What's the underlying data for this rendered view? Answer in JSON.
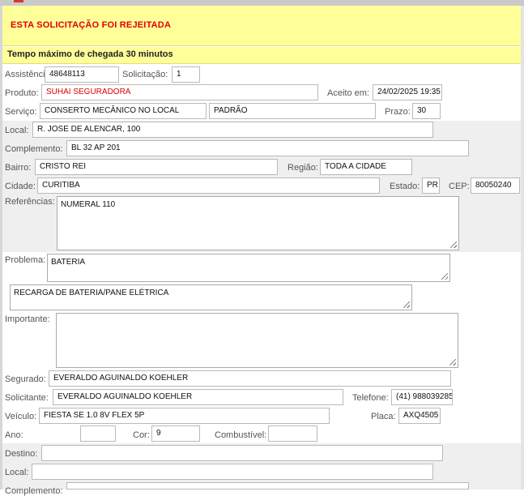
{
  "banner": {
    "rejected_text": "ESTA SOLICITAÇÃO FOI REJEITADA"
  },
  "tempo": {
    "text": "Tempo máximo de chegada 30 minutos"
  },
  "labels": {
    "assistencia": "Assistência:",
    "solicitacao": "Solicitação:",
    "produto": "Produto:",
    "aceito_em": "Aceito em:",
    "servico": "Serviço:",
    "prazo": "Prazo:",
    "local": "Local:",
    "complemento": "Complemento:",
    "bairro": "Bairro:",
    "regiao": "Região:",
    "cidade": "Cidade:",
    "estado": "Estado:",
    "cep": "CEP:",
    "referencias": "Referências:",
    "problema": "Problema:",
    "importante": "Importante:",
    "segurado": "Segurado:",
    "solicitante": "Solicitante:",
    "telefone": "Telefone:",
    "veiculo": "Veículo:",
    "placa": "Placa:",
    "ano": "Ano:",
    "cor": "Cor:",
    "combustivel": "Combustível:",
    "destino": "Destino:",
    "local2": "Local:",
    "complemento2": "Complemento:"
  },
  "values": {
    "assistencia": "48648113",
    "solicitacao": "1",
    "produto": "SUHAI SEGURADORA",
    "aceito_em": "24/02/2025 19:35",
    "servico": "CONSERTO MECÂNICO NO LOCAL",
    "servico_tipo": "PADRÃO",
    "prazo": "30",
    "local": "R. JOSE DE ALENCAR, 100",
    "complemento": "BL 32 AP 201",
    "bairro": "CRISTO REI",
    "regiao": "TODA A CIDADE",
    "cidade": "CURITIBA",
    "estado": "PR",
    "cep": "80050240",
    "referencias": "NUMERAL 110",
    "problema": "BATERIA",
    "problema_detalhe": "RECARGA DE BATERIA/PANE ELÉTRICA",
    "importante": "",
    "segurado": "EVERALDO AGUINALDO KOEHLER",
    "solicitante": "EVERALDO AGUINALDO KOEHLER",
    "telefone": "(41) 988039285",
    "veiculo": "FIESTA SE 1.0 8V FLEX 5P",
    "placa": "AXQ4505",
    "ano": "",
    "cor": "9",
    "combustivel": "",
    "destino": "",
    "local2": "",
    "complemento2": ""
  },
  "colors": {
    "rejected": "#e00000",
    "banner_bg": "#ffff99",
    "row_grey": "#efefef"
  }
}
